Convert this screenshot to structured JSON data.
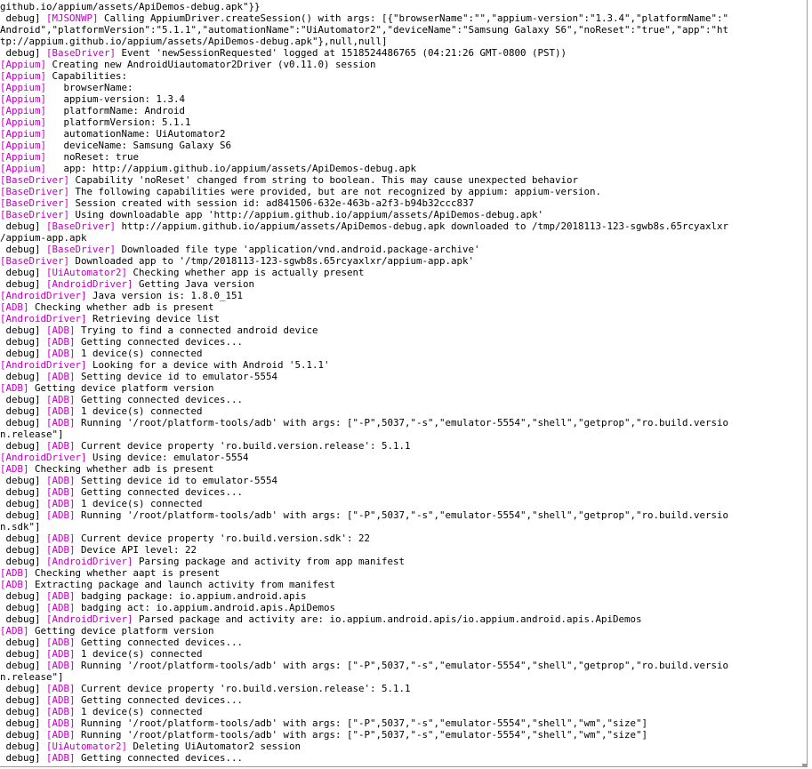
{
  "terminal": {
    "colors": {
      "background": "#ffffff",
      "text": "#000000",
      "tag": "#c000c0",
      "border": "#9a9a9a"
    },
    "lines": [
      [
        {
          "t": "github.io/appium/assets/ApiDemos-debug.apk\"}}"
        }
      ],
      [
        {
          "t": " debug] "
        },
        {
          "t": "[MJSONWP]",
          "tag": true
        },
        {
          "t": " Calling AppiumDriver.createSession() with args: [{\"browserName\":\"\",\"appium-version\":\"1.3.4\",\"platformName\":\""
        }
      ],
      [
        {
          "t": "Android\",\"platformVersion\":\"5.1.1\",\"automationName\":\"UiAutomator2\",\"deviceName\":\"Samsung Galaxy S6\",\"noReset\":\"true\",\"app\":\"ht"
        }
      ],
      [
        {
          "t": "tp://appium.github.io/appium/assets/ApiDemos-debug.apk\"},null,null]"
        }
      ],
      [
        {
          "t": " debug] "
        },
        {
          "t": "[BaseDriver]",
          "tag": true
        },
        {
          "t": " Event 'newSessionRequested' logged at 1518524486765 (04:21:26 GMT-0800 (PST))"
        }
      ],
      [
        {
          "t": "[Appium]",
          "tag": true
        },
        {
          "t": " Creating new AndroidUiautomator2Driver (v0.11.0) session"
        }
      ],
      [
        {
          "t": "[Appium]",
          "tag": true
        },
        {
          "t": " Capabilities:"
        }
      ],
      [
        {
          "t": "[Appium]",
          "tag": true
        },
        {
          "t": "   browserName:"
        }
      ],
      [
        {
          "t": "[Appium]",
          "tag": true
        },
        {
          "t": "   appium-version: 1.3.4"
        }
      ],
      [
        {
          "t": "[Appium]",
          "tag": true
        },
        {
          "t": "   platformName: Android"
        }
      ],
      [
        {
          "t": "[Appium]",
          "tag": true
        },
        {
          "t": "   platformVersion: 5.1.1"
        }
      ],
      [
        {
          "t": "[Appium]",
          "tag": true
        },
        {
          "t": "   automationName: UiAutomator2"
        }
      ],
      [
        {
          "t": "[Appium]",
          "tag": true
        },
        {
          "t": "   deviceName: Samsung Galaxy S6"
        }
      ],
      [
        {
          "t": "[Appium]",
          "tag": true
        },
        {
          "t": "   noReset: true"
        }
      ],
      [
        {
          "t": "[Appium]",
          "tag": true
        },
        {
          "t": "   app: http://appium.github.io/appium/assets/ApiDemos-debug.apk"
        }
      ],
      [
        {
          "t": "[BaseDriver]",
          "tag": true
        },
        {
          "t": " Capability 'noReset' changed from string to boolean. This may cause unexpected behavior"
        }
      ],
      [
        {
          "t": "[BaseDriver]",
          "tag": true
        },
        {
          "t": " The following capabilities were provided, but are not recognized by appium: appium-version."
        }
      ],
      [
        {
          "t": "[BaseDriver]",
          "tag": true
        },
        {
          "t": " Session created with session id: ad841506-632e-463b-a2f3-b94b32ccc837"
        }
      ],
      [
        {
          "t": "[BaseDriver]",
          "tag": true
        },
        {
          "t": " Using downloadable app 'http://appium.github.io/appium/assets/ApiDemos-debug.apk'"
        }
      ],
      [
        {
          "t": " debug] "
        },
        {
          "t": "[BaseDriver]",
          "tag": true
        },
        {
          "t": " http://appium.github.io/appium/assets/ApiDemos-debug.apk downloaded to /tmp/2018113-123-sgwb8s.65rcyaxlxr"
        }
      ],
      [
        {
          "t": "/appium-app.apk"
        }
      ],
      [
        {
          "t": " debug] "
        },
        {
          "t": "[BaseDriver]",
          "tag": true
        },
        {
          "t": " Downloaded file type 'application/vnd.android.package-archive'"
        }
      ],
      [
        {
          "t": "[BaseDriver]",
          "tag": true
        },
        {
          "t": " Downloaded app to '/tmp/2018113-123-sgwb8s.65rcyaxlxr/appium-app.apk'"
        }
      ],
      [
        {
          "t": " debug] "
        },
        {
          "t": "[UiAutomator2]",
          "tag": true
        },
        {
          "t": " Checking whether app is actually present"
        }
      ],
      [
        {
          "t": " debug] "
        },
        {
          "t": "[AndroidDriver]",
          "tag": true
        },
        {
          "t": " Getting Java version"
        }
      ],
      [
        {
          "t": "[AndroidDriver]",
          "tag": true
        },
        {
          "t": " Java version is: 1.8.0_151"
        }
      ],
      [
        {
          "t": "[ADB]",
          "tag": true
        },
        {
          "t": " Checking whether adb is present"
        }
      ],
      [
        {
          "t": "[AndroidDriver]",
          "tag": true
        },
        {
          "t": " Retrieving device list"
        }
      ],
      [
        {
          "t": " debug] "
        },
        {
          "t": "[ADB]",
          "tag": true
        },
        {
          "t": " Trying to find a connected android device"
        }
      ],
      [
        {
          "t": " debug] "
        },
        {
          "t": "[ADB]",
          "tag": true
        },
        {
          "t": " Getting connected devices..."
        }
      ],
      [
        {
          "t": " debug] "
        },
        {
          "t": "[ADB]",
          "tag": true
        },
        {
          "t": " 1 device(s) connected"
        }
      ],
      [
        {
          "t": "[AndroidDriver]",
          "tag": true
        },
        {
          "t": " Looking for a device with Android '5.1.1'"
        }
      ],
      [
        {
          "t": " debug] "
        },
        {
          "t": "[ADB]",
          "tag": true
        },
        {
          "t": " Setting device id to emulator-5554"
        }
      ],
      [
        {
          "t": "[ADB]",
          "tag": true
        },
        {
          "t": " Getting device platform version"
        }
      ],
      [
        {
          "t": " debug] "
        },
        {
          "t": "[ADB]",
          "tag": true
        },
        {
          "t": " Getting connected devices..."
        }
      ],
      [
        {
          "t": " debug] "
        },
        {
          "t": "[ADB]",
          "tag": true
        },
        {
          "t": " 1 device(s) connected"
        }
      ],
      [
        {
          "t": " debug] "
        },
        {
          "t": "[ADB]",
          "tag": true
        },
        {
          "t": " Running '/root/platform-tools/adb' with args: [\"-P\",5037,\"-s\",\"emulator-5554\",\"shell\",\"getprop\",\"ro.build.versio"
        }
      ],
      [
        {
          "t": "n.release\"]"
        }
      ],
      [
        {
          "t": " debug] "
        },
        {
          "t": "[ADB]",
          "tag": true
        },
        {
          "t": " Current device property 'ro.build.version.release': 5.1.1"
        }
      ],
      [
        {
          "t": "[AndroidDriver]",
          "tag": true
        },
        {
          "t": " Using device: emulator-5554"
        }
      ],
      [
        {
          "t": "[ADB]",
          "tag": true
        },
        {
          "t": " Checking whether adb is present"
        }
      ],
      [
        {
          "t": " debug] "
        },
        {
          "t": "[ADB]",
          "tag": true
        },
        {
          "t": " Setting device id to emulator-5554"
        }
      ],
      [
        {
          "t": " debug] "
        },
        {
          "t": "[ADB]",
          "tag": true
        },
        {
          "t": " Getting connected devices..."
        }
      ],
      [
        {
          "t": " debug] "
        },
        {
          "t": "[ADB]",
          "tag": true
        },
        {
          "t": " 1 device(s) connected"
        }
      ],
      [
        {
          "t": " debug] "
        },
        {
          "t": "[ADB]",
          "tag": true
        },
        {
          "t": " Running '/root/platform-tools/adb' with args: [\"-P\",5037,\"-s\",\"emulator-5554\",\"shell\",\"getprop\",\"ro.build.versio"
        }
      ],
      [
        {
          "t": "n.sdk\"]"
        }
      ],
      [
        {
          "t": " debug] "
        },
        {
          "t": "[ADB]",
          "tag": true
        },
        {
          "t": " Current device property 'ro.build.version.sdk': 22"
        }
      ],
      [
        {
          "t": " debug] "
        },
        {
          "t": "[ADB]",
          "tag": true
        },
        {
          "t": " Device API level: 22"
        }
      ],
      [
        {
          "t": " debug] "
        },
        {
          "t": "[AndroidDriver]",
          "tag": true
        },
        {
          "t": " Parsing package and activity from app manifest"
        }
      ],
      [
        {
          "t": "[ADB]",
          "tag": true
        },
        {
          "t": " Checking whether aapt is present"
        }
      ],
      [
        {
          "t": "[ADB]",
          "tag": true
        },
        {
          "t": " Extracting package and launch activity from manifest"
        }
      ],
      [
        {
          "t": " debug] "
        },
        {
          "t": "[ADB]",
          "tag": true
        },
        {
          "t": " badging package: io.appium.android.apis"
        }
      ],
      [
        {
          "t": " debug] "
        },
        {
          "t": "[ADB]",
          "tag": true
        },
        {
          "t": " badging act: io.appium.android.apis.ApiDemos"
        }
      ],
      [
        {
          "t": " debug] "
        },
        {
          "t": "[AndroidDriver]",
          "tag": true
        },
        {
          "t": " Parsed package and activity are: io.appium.android.apis/io.appium.android.apis.ApiDemos"
        }
      ],
      [
        {
          "t": "[ADB]",
          "tag": true
        },
        {
          "t": " Getting device platform version"
        }
      ],
      [
        {
          "t": " debug] "
        },
        {
          "t": "[ADB]",
          "tag": true
        },
        {
          "t": " Getting connected devices..."
        }
      ],
      [
        {
          "t": " debug] "
        },
        {
          "t": "[ADB]",
          "tag": true
        },
        {
          "t": " 1 device(s) connected"
        }
      ],
      [
        {
          "t": " debug] "
        },
        {
          "t": "[ADB]",
          "tag": true
        },
        {
          "t": " Running '/root/platform-tools/adb' with args: [\"-P\",5037,\"-s\",\"emulator-5554\",\"shell\",\"getprop\",\"ro.build.versio"
        }
      ],
      [
        {
          "t": "n.release\"]"
        }
      ],
      [
        {
          "t": " debug] "
        },
        {
          "t": "[ADB]",
          "tag": true
        },
        {
          "t": " Current device property 'ro.build.version.release': 5.1.1"
        }
      ],
      [
        {
          "t": " debug] "
        },
        {
          "t": "[ADB]",
          "tag": true
        },
        {
          "t": " Getting connected devices..."
        }
      ],
      [
        {
          "t": " debug] "
        },
        {
          "t": "[ADB]",
          "tag": true
        },
        {
          "t": " 1 device(s) connected"
        }
      ],
      [
        {
          "t": " debug] "
        },
        {
          "t": "[ADB]",
          "tag": true
        },
        {
          "t": " Running '/root/platform-tools/adb' with args: [\"-P\",5037,\"-s\",\"emulator-5554\",\"shell\",\"wm\",\"size\"]"
        }
      ],
      [
        {
          "t": " debug] "
        },
        {
          "t": "[ADB]",
          "tag": true
        },
        {
          "t": " Running '/root/platform-tools/adb' with args: [\"-P\",5037,\"-s\",\"emulator-5554\",\"shell\",\"wm\",\"size\"]"
        }
      ],
      [
        {
          "t": " debug] "
        },
        {
          "t": "[UiAutomator2]",
          "tag": true
        },
        {
          "t": " Deleting UiAutomator2 session"
        }
      ],
      [
        {
          "t": " debug] "
        },
        {
          "t": "[ADB]",
          "tag": true
        },
        {
          "t": " Getting connected devices..."
        }
      ]
    ]
  }
}
